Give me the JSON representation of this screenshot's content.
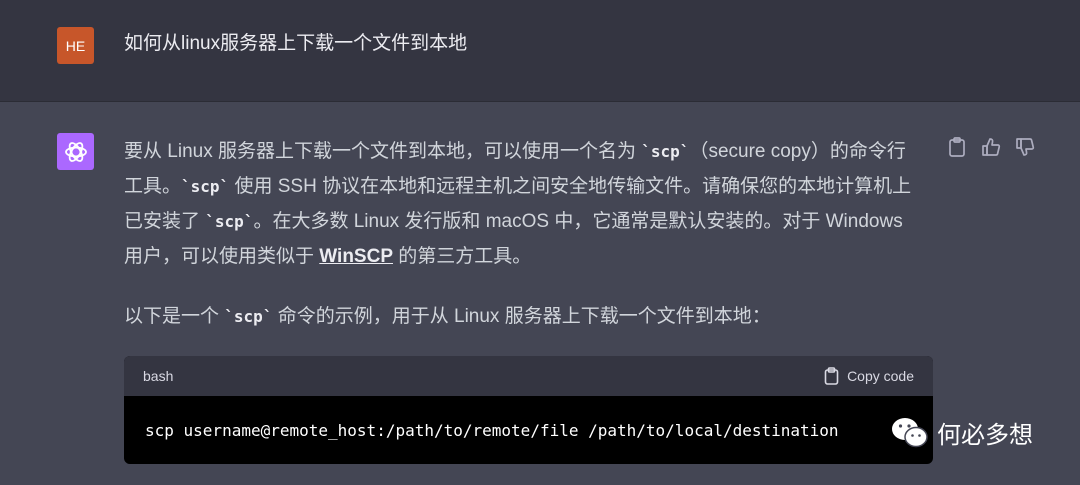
{
  "user": {
    "avatar_initials": "HE",
    "message": "如何从linux服务器上下载一个文件到本地"
  },
  "assistant": {
    "avatar_icon": "openai-logo-icon",
    "p1": {
      "t1": "要从 Linux 服务器上下载一个文件到本地，可以使用一个名为 ",
      "c1": "`scp`",
      "t2": "（secure copy）的命令行工具。",
      "c2": "`scp`",
      "t3": " 使用 SSH 协议在本地和远程主机之间安全地传输文件。请确保您的本地计算机上已安装了 ",
      "c3": "`scp`",
      "t4": "。在大多数 Linux 发行版和 macOS 中，它通常是默认安装的。对于 Windows 用户，可以使用类似于 ",
      "link": "WinSCP",
      "t5": " 的第三方工具。"
    },
    "p2": {
      "t1": "以下是一个 ",
      "c1": "`scp`",
      "t2": " 命令的示例，用于从 Linux 服务器上下载一个文件到本地："
    }
  },
  "actions": [
    "clipboard-icon",
    "thumbs-up-icon",
    "thumbs-down-icon"
  ],
  "code_block": {
    "language": "bash",
    "copy_label": "Copy code",
    "code": "scp username@remote_host:/path/to/remote/file /path/to/local/destination"
  },
  "watermark": {
    "text": "何必多想",
    "icon": "wechat-icon"
  },
  "colors": {
    "user_bg": "#343541",
    "assistant_bg": "#444654",
    "user_avatar": "#c7562a",
    "bot_avatar": "#ab68ff",
    "code_bg": "#000000"
  }
}
